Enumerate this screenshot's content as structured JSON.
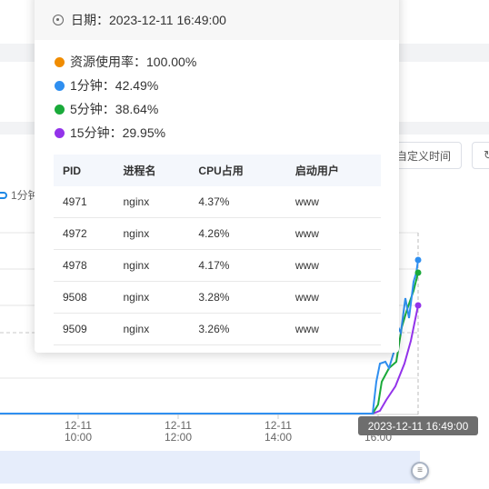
{
  "tooltip": {
    "date_label": "日期：2023-12-11 16:49:00",
    "metrics": [
      {
        "label": "资源使用率：100.00%",
        "color": "#f08c00"
      },
      {
        "label": "1分钟：42.49%",
        "color": "#2f8ff0"
      },
      {
        "label": "5分钟：38.64%",
        "color": "#1aaa3a"
      },
      {
        "label": "15分钟：29.95%",
        "color": "#9333ea"
      }
    ],
    "table_headers": [
      "PID",
      "进程名",
      "CPU占用",
      "启动用户"
    ],
    "rows": [
      [
        "4971",
        "nginx",
        "4.37%",
        "www"
      ],
      [
        "4972",
        "nginx",
        "4.26%",
        "www"
      ],
      [
        "4978",
        "nginx",
        "4.17%",
        "www"
      ],
      [
        "9508",
        "nginx",
        "3.28%",
        "www"
      ],
      [
        "9509",
        "nginx",
        "3.26%",
        "www"
      ]
    ]
  },
  "toolbar": {
    "custom_time_label": "自定义时间",
    "refresh_icon": "refresh-icon"
  },
  "legend": {
    "first_label": "1分钟"
  },
  "chart_data": {
    "type": "line",
    "x_ticks": [
      {
        "date": "12-11",
        "time": "10:00"
      },
      {
        "date": "12-11",
        "time": "12:00"
      },
      {
        "date": "12-11",
        "time": "14:00"
      },
      {
        "date": "",
        "time": "16:00"
      }
    ],
    "hover_time": "2023-12-11 16:49:00",
    "series": [
      {
        "name": "1分钟",
        "color": "#2f8ff0",
        "final": 42.49
      },
      {
        "name": "5分钟",
        "color": "#1aaa3a",
        "final": 38.64
      },
      {
        "name": "15分钟",
        "color": "#9333ea",
        "final": 29.95
      }
    ]
  }
}
